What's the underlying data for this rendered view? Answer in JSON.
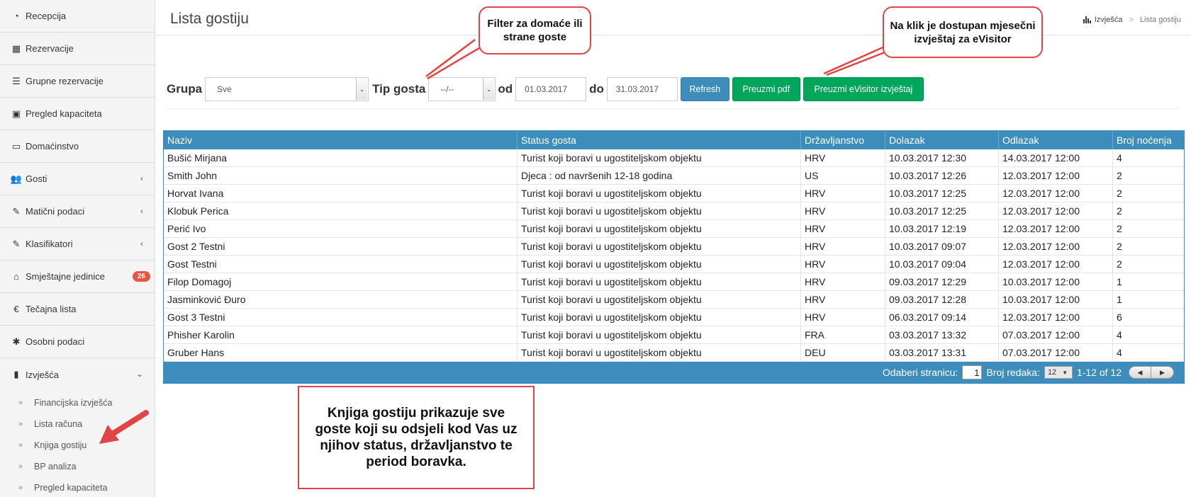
{
  "sidebar": {
    "items": [
      {
        "label": "Recepcija",
        "icon": "dashboard-icon",
        "glyph": "◔"
      },
      {
        "label": "Rezervacije",
        "icon": "grid-icon",
        "glyph": "▦"
      },
      {
        "label": "Grupne rezervacije",
        "icon": "list-icon",
        "glyph": "☰"
      },
      {
        "label": "Pregled kapaciteta",
        "icon": "calendar-icon",
        "glyph": "▣"
      },
      {
        "label": "Domaćinstvo",
        "icon": "window-icon",
        "glyph": "▭"
      },
      {
        "label": "Gosti",
        "icon": "users-icon",
        "glyph": "👥",
        "chevron": "‹"
      },
      {
        "label": "Matični podaci",
        "icon": "edit-icon",
        "glyph": "✎",
        "chevron": "‹"
      },
      {
        "label": "Klasifikatori",
        "icon": "edit-icon",
        "glyph": "✎",
        "chevron": "‹"
      },
      {
        "label": "Smještajne jedinice",
        "icon": "home-icon",
        "glyph": "⌂",
        "badge": "26"
      },
      {
        "label": "Tečajna lista",
        "icon": "euro-icon",
        "glyph": "€"
      },
      {
        "label": "Osobni podaci",
        "icon": "asterisk-icon",
        "glyph": "✱"
      }
    ],
    "reports": {
      "label": "Izvješća",
      "icon": "bar-chart-icon",
      "glyph": "▮",
      "chevron": "⌄",
      "subitems": [
        "Financijska izvješća",
        "Lista računa",
        "Knjiga gostiju",
        "BP analiza",
        "Pregled kapaciteta"
      ],
      "sub_glyph": "»"
    }
  },
  "header": {
    "title": "Lista gostiju",
    "breadcrumb": {
      "parent": "Izvješća",
      "current": "Lista gostiju",
      "separator": ">",
      "icon": "bar-chart-icon"
    }
  },
  "filters": {
    "group_label": "Grupa",
    "group_value": "Sve",
    "guest_type_label": "Tip gosta",
    "guest_type_value": "--/--",
    "from_label": "od",
    "from_value": "01.03.2017",
    "to_label": "do",
    "to_value": "31.03.2017",
    "refresh_label": "Refresh",
    "pdf_label": "Preuzmi pdf",
    "evisitor_label": "Preuzmi eVisitor izvještaj",
    "dropdown_arrow": "⌄"
  },
  "table": {
    "columns": [
      "Naziv",
      "Status gosta",
      "Državljanstvo",
      "Dolazak",
      "Odlazak",
      "Broj noćenja"
    ],
    "rows": [
      [
        "Bušić Mirjana",
        "Turist koji boravi u ugostiteljskom objektu",
        "HRV",
        "10.03.2017 12:30",
        "14.03.2017 12:00",
        "4"
      ],
      [
        "Smith John",
        "Djeca : od navršenih 12-18 godina",
        "US",
        "10.03.2017 12:26",
        "12.03.2017 12:00",
        "2"
      ],
      [
        "Horvat Ivana",
        "Turist koji boravi u ugostiteljskom objektu",
        "HRV",
        "10.03.2017 12:25",
        "12.03.2017 12:00",
        "2"
      ],
      [
        "Klobuk Perica",
        "Turist koji boravi u ugostiteljskom objektu",
        "HRV",
        "10.03.2017 12:25",
        "12.03.2017 12:00",
        "2"
      ],
      [
        "Perić Ivo",
        "Turist koji boravi u ugostiteljskom objektu",
        "HRV",
        "10.03.2017 12:19",
        "12.03.2017 12:00",
        "2"
      ],
      [
        "Gost 2 Testni",
        "Turist koji boravi u ugostiteljskom objektu",
        "HRV",
        "10.03.2017 09:07",
        "12.03.2017 12:00",
        "2"
      ],
      [
        "Gost Testni",
        "Turist koji boravi u ugostiteljskom objektu",
        "HRV",
        "10.03.2017 09:04",
        "12.03.2017 12:00",
        "2"
      ],
      [
        "Filop Domagoj",
        "Turist koji boravi u ugostiteljskom objektu",
        "HRV",
        "09.03.2017 12:29",
        "10.03.2017 12:00",
        "1"
      ],
      [
        "Jasminković Đuro",
        "Turist koji boravi u ugostiteljskom objektu",
        "HRV",
        "09.03.2017 12:28",
        "10.03.2017 12:00",
        "1"
      ],
      [
        "Gost 3 Testni",
        "Turist koji boravi u ugostiteljskom objektu",
        "HRV",
        "06.03.2017 09:14",
        "12.03.2017 12:00",
        "6"
      ],
      [
        "Phisher Karolin",
        "Turist koji boravi u ugostiteljskom objektu",
        "FRA",
        "03.03.2017 13:32",
        "07.03.2017 12:00",
        "4"
      ],
      [
        "Gruber Hans",
        "Turist koji boravi u ugostiteljskom objektu",
        "DEU",
        "03.03.2017 13:31",
        "07.03.2017 12:00",
        "4"
      ]
    ]
  },
  "pager": {
    "page_label": "Odaberi stranicu:",
    "page_value": "1",
    "rows_label": "Broj redaka:",
    "rows_value": "12",
    "range": "1-12 of 12",
    "prev_glyph": "◀",
    "next_glyph": "▶",
    "select_arrow": "▼"
  },
  "callouts": {
    "filter_note": "Filter za domaće ili strane goste",
    "evisitor_note": "Na klik je dostupan mjesečni izvještaj za eVisitor",
    "book_note": "Knjiga gostiju prikazuje sve goste koji su odsjeli kod Vas uz njihov status, državljanstvo te period boravka."
  },
  "colors": {
    "primary": "#3c8dbc",
    "success": "#00a65a",
    "badge": "#e7543f",
    "callout": "#e24444"
  }
}
